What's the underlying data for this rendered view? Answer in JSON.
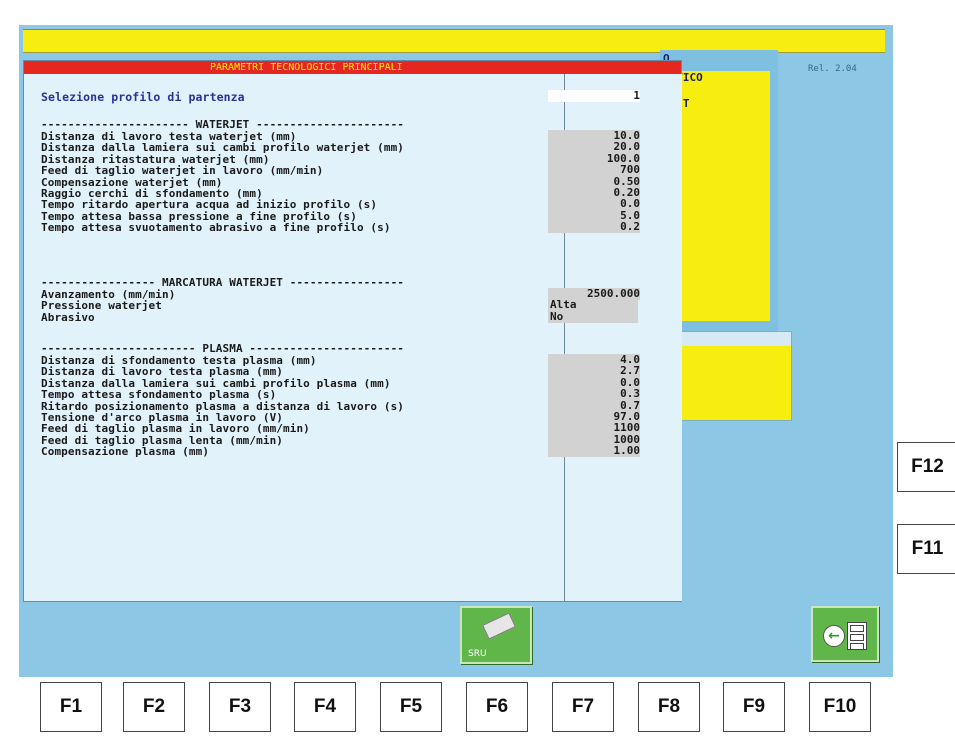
{
  "dialog": {
    "title": "PARAMETRI TECNOLOGICI PRINCIPALI",
    "start_profile": {
      "label": "Selezione profilo di partenza",
      "value": "1"
    },
    "sections": [
      {
        "header": "---------------------- WATERJET ----------------------",
        "rows": [
          {
            "label": "Distanza di lavoro testa waterjet (mm)",
            "value": "10.0"
          },
          {
            "label": "Distanza dalla lamiera sui cambi profilo waterjet (mm)",
            "value": "20.0"
          },
          {
            "label": "Distanza ritastatura waterjet (mm)",
            "value": "100.0"
          },
          {
            "label": "Feed di taglio waterjet in lavoro (mm/min)",
            "value": "700"
          },
          {
            "label": "Compensazione waterjet (mm)",
            "value": "0.50"
          },
          {
            "label": "Raggio cerchi di sfondamento (mm)",
            "value": "0.20"
          },
          {
            "label": "Tempo ritardo apertura acqua ad inizio profilo (s)",
            "value": "0.0"
          },
          {
            "label": "Tempo attesa bassa pressione a fine profilo (s)",
            "value": "5.0"
          },
          {
            "label": "Tempo attesa svuotamento abrasivo a fine profilo (s)",
            "value": "0.2"
          }
        ]
      },
      {
        "header": "----------------- MARCATURA WATERJET -----------------",
        "rows": [
          {
            "label": "Avanzamento (mm/min)",
            "value": "2500.000"
          },
          {
            "label": "Pressione waterjet",
            "value": "Alta"
          },
          {
            "label": "Abrasivo",
            "value": "No"
          }
        ]
      },
      {
        "header": "----------------------- PLASMA -----------------------",
        "rows": [
          {
            "label": "Distanza di sfondamento testa plasma (mm)",
            "value": "4.0"
          },
          {
            "label": "Distanza di lavoro testa plasma (mm)",
            "value": "2.7"
          },
          {
            "label": "Distanza dalla lamiera sui cambi profilo plasma (mm)",
            "value": "0.0"
          },
          {
            "label": "Tempo attesa sfondamento plasma (s)",
            "value": "0.3"
          },
          {
            "label": "Ritardo posizionamento plasma a distanza di lavoro (s)",
            "value": "0.7"
          },
          {
            "label": "Tensione d'arco plasma in lavoro (V)",
            "value": "97.0"
          },
          {
            "label": "Feed di taglio plasma in lavoro (mm/min)",
            "value": "1100"
          },
          {
            "label": "Feed di taglio plasma lenta (mm/min)",
            "value": "1000"
          },
          {
            "label": "Compensazione plasma (mm)",
            "value": "1.00"
          }
        ]
      }
    ]
  },
  "background_window": {
    "title_fragment": "O",
    "line1": "MATICO",
    "line2": "RJET",
    "release": "Rel. 2.04"
  },
  "buttons": {
    "sru_label": "SRU"
  },
  "fkeys": {
    "bottom": [
      "F1",
      "F2",
      "F3",
      "F4",
      "F5",
      "F6",
      "F7",
      "F8",
      "F9",
      "F10"
    ],
    "side": [
      "F12",
      "F11"
    ]
  },
  "colors": {
    "screen_bg": "#8cc7e6",
    "title_bar": "#e5281f",
    "title_text": "#f7ee10",
    "top_bar": "#f7ee10",
    "button_green": "#61b64a"
  }
}
